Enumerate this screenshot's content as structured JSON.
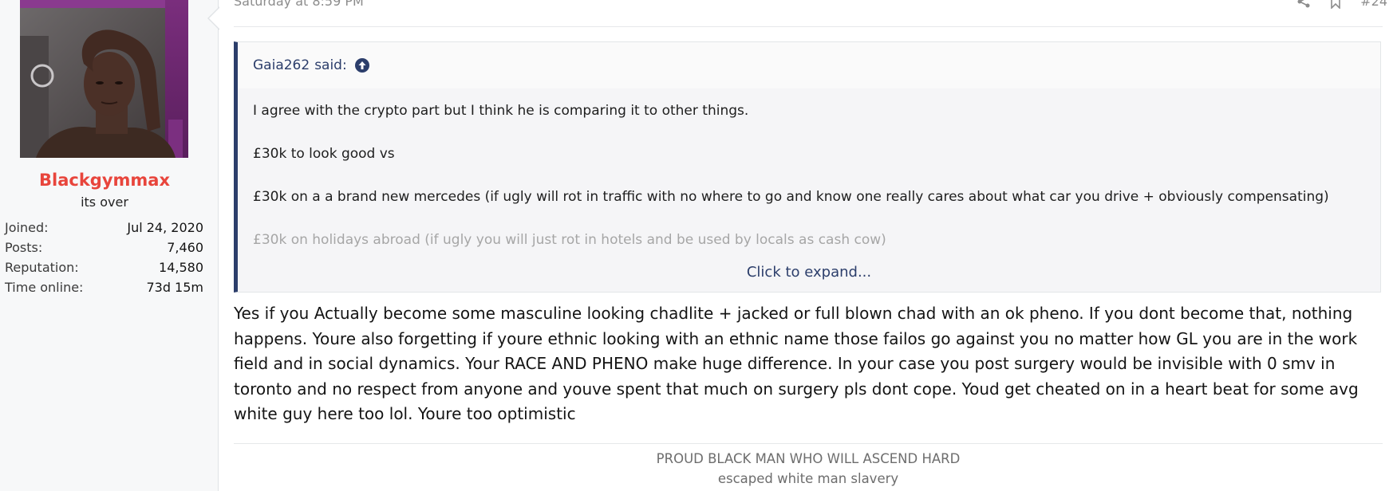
{
  "user": {
    "avatar_alt": "user avatar",
    "name": "Blackgymmax",
    "title": "its over",
    "stats": [
      {
        "label": "Joined:",
        "value": "Jul 24, 2020"
      },
      {
        "label": "Posts:",
        "value": "7,460"
      },
      {
        "label": "Reputation:",
        "value": "14,580"
      },
      {
        "label": "Time online:",
        "value": "73d 15m"
      }
    ]
  },
  "header": {
    "date": "Saturday at 8:59 PM",
    "post_number": "#24",
    "icons": [
      "share-icon",
      "bookmark-icon"
    ]
  },
  "quote": {
    "author": "Gaia262",
    "said": "said:",
    "lines": [
      "I agree with the crypto part but I think he is comparing it to other things.",
      "£30k to look good vs",
      "£30k on a a brand new mercedes (if ugly will rot in traffic with no where to go and know one really cares about what car you drive + obviously compensating)",
      "£30k on holidays abroad (if ugly you will just rot in hotels and be used by locals as cash cow)"
    ],
    "expand_label": "Click to expand..."
  },
  "message": {
    "text": "Yes if you Actually become some masculine looking chadlite + jacked or full blown chad with an ok pheno. If you dont become that, nothing happens. Youre also forgetting if youre ethnic looking with an ethnic name those failos go against you no matter how GL you are in the work field and in social dynamics. Your RACE AND PHENO make huge difference. In your case you post surgery would be invisible with 0 smv in toronto and no respect from anyone and youve spent that much on surgery pls dont cope. Youd get cheated on in a heart beat for some avg white guy here too lol. Youre too optimistic"
  },
  "signature": {
    "line1": "PROUD BLACK MAN WHO WILL ASCEND HARD",
    "line2": "escaped white man slavery"
  },
  "colors": {
    "username": "#e8453c",
    "quote_accent": "#2c3e6b",
    "sidebar_bg": "#f7f8f9"
  }
}
